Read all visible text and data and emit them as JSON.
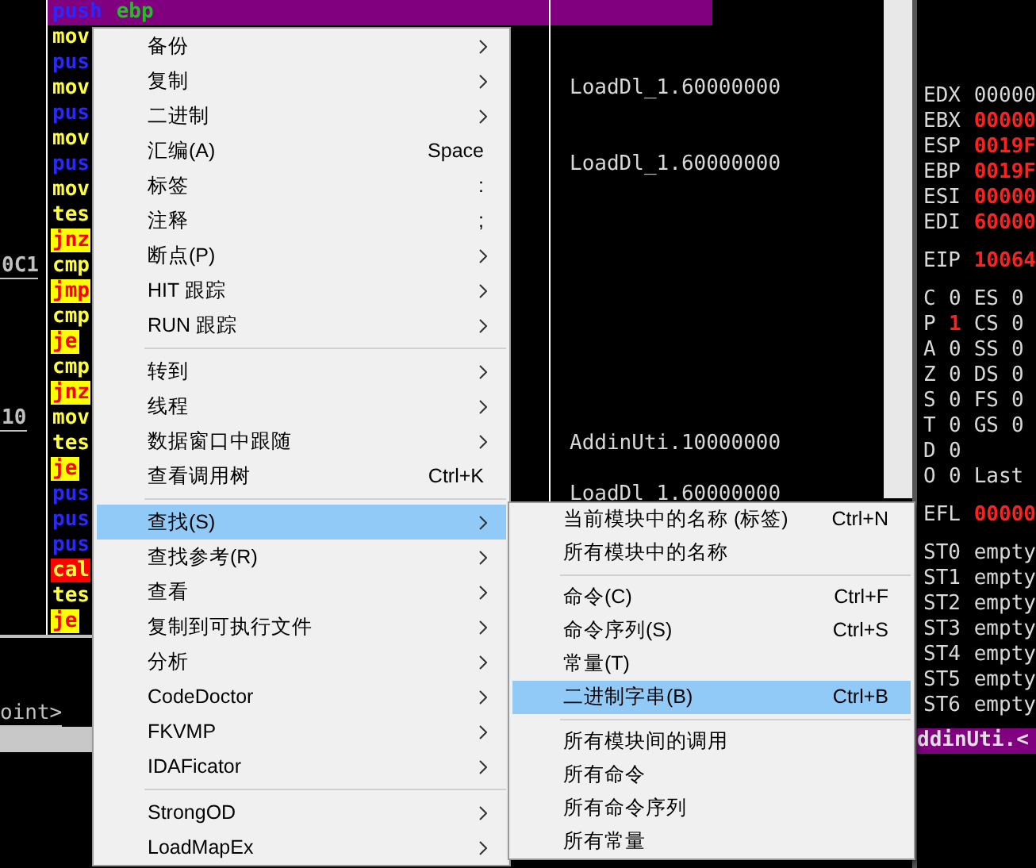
{
  "listing": [
    {
      "mnemonic": "push",
      "operand": "ebp",
      "kind": "push",
      "selected": true
    },
    {
      "mnemonic": "mov",
      "kind": "move",
      "selected": false
    },
    {
      "mnemonic": "pus",
      "kind": "push",
      "selected": false
    },
    {
      "mnemonic": "mov",
      "kind": "move",
      "comment": "LoadDl_1.60000000",
      "selected": false
    },
    {
      "mnemonic": "pus",
      "kind": "push",
      "selected": false
    },
    {
      "mnemonic": "mov",
      "kind": "move",
      "selected": false
    },
    {
      "mnemonic": "pus",
      "kind": "push",
      "comment": "LoadDl_1.60000000",
      "selected": false
    },
    {
      "mnemonic": "mov",
      "kind": "move",
      "selected": false
    },
    {
      "mnemonic": "tes",
      "kind": "test",
      "selected": false
    },
    {
      "mnemonic": "jnz",
      "kind": "jump",
      "selected": false
    },
    {
      "address": "0C1",
      "mnemonic": "cmp",
      "kind": "compare",
      "selected": false
    },
    {
      "mnemonic": "jmp",
      "kind": "jump",
      "selected": false
    },
    {
      "mnemonic": "cmp",
      "kind": "compare",
      "selected": false
    },
    {
      "mnemonic": "je",
      "kind": "jump",
      "selected": false
    },
    {
      "mnemonic": "cmp",
      "kind": "compare",
      "selected": false
    },
    {
      "mnemonic": "jnz",
      "kind": "jump",
      "selected": false
    },
    {
      "address": "10",
      "mnemonic": "mov",
      "kind": "move",
      "selected": false
    },
    {
      "mnemonic": "tes",
      "kind": "test",
      "comment": "AddinUti.10000000",
      "selected": false
    },
    {
      "mnemonic": "je",
      "kind": "jump",
      "selected": false
    },
    {
      "mnemonic": "pus",
      "kind": "push",
      "comment": "LoadDl_1.60000000",
      "selected": false
    },
    {
      "mnemonic": "pus",
      "kind": "push",
      "selected": false
    },
    {
      "mnemonic": "pus",
      "kind": "push",
      "selected": false
    },
    {
      "mnemonic": "cal",
      "kind": "call",
      "selected": false
    },
    {
      "mnemonic": "tes",
      "kind": "test",
      "selected": false
    },
    {
      "mnemonic": "je",
      "kind": "jump",
      "selected": false
    }
  ],
  "bottom_pane": {
    "text": "oint>"
  },
  "registers": [
    {
      "kind": "register",
      "name": "EDX",
      "value": "00000",
      "changed": false
    },
    {
      "kind": "register",
      "name": "EBX",
      "value": "00000",
      "changed": true
    },
    {
      "kind": "register",
      "name": "ESP",
      "value": "0019F",
      "changed": true
    },
    {
      "kind": "register",
      "name": "EBP",
      "value": "0019F",
      "changed": true
    },
    {
      "kind": "register",
      "name": "ESI",
      "value": "00000",
      "changed": true
    },
    {
      "kind": "register",
      "name": "EDI",
      "value": "60000",
      "changed": true
    },
    {
      "kind": "gap"
    },
    {
      "kind": "register",
      "name": "EIP",
      "value": "10064",
      "changed": true
    },
    {
      "kind": "gap"
    },
    {
      "kind": "flag",
      "name": "C",
      "value": "0",
      "changed": false,
      "segment": "ES",
      "segment_value": "0"
    },
    {
      "kind": "flag",
      "name": "P",
      "value": "1",
      "changed": true,
      "segment": "CS",
      "segment_value": "0"
    },
    {
      "kind": "flag",
      "name": "A",
      "value": "0",
      "changed": false,
      "segment": "SS",
      "segment_value": "0"
    },
    {
      "kind": "flag",
      "name": "Z",
      "value": "0",
      "changed": false,
      "segment": "DS",
      "segment_value": "0"
    },
    {
      "kind": "flag",
      "name": "S",
      "value": "0",
      "changed": false,
      "segment": "FS",
      "segment_value": "0"
    },
    {
      "kind": "flag",
      "name": "T",
      "value": "0",
      "changed": false,
      "segment": "GS",
      "segment_value": "0"
    },
    {
      "kind": "flag",
      "name": "D",
      "value": "0",
      "changed": false
    },
    {
      "kind": "flag",
      "name": "O",
      "value": "0",
      "changed": false,
      "segment": "Last"
    },
    {
      "kind": "gap"
    },
    {
      "kind": "register",
      "name": "EFL",
      "value": "00000",
      "changed": true
    },
    {
      "kind": "gap"
    },
    {
      "kind": "register",
      "name": "ST0",
      "value": "empty",
      "changed": false
    },
    {
      "kind": "register",
      "name": "ST1",
      "value": "empty",
      "changed": false
    },
    {
      "kind": "register",
      "name": "ST2",
      "value": "empty",
      "changed": false
    },
    {
      "kind": "register",
      "name": "ST3",
      "value": "empty",
      "changed": false
    },
    {
      "kind": "register",
      "name": "ST4",
      "value": "empty",
      "changed": false
    },
    {
      "kind": "register",
      "name": "ST5",
      "value": "empty",
      "changed": false
    },
    {
      "kind": "register",
      "name": "ST6",
      "value": "empty",
      "changed": false
    }
  ],
  "stack_pane": {
    "text": "ddinUti.<"
  },
  "context_menu": [
    {
      "kind": "item",
      "label": "备份",
      "submenu": true,
      "selected": false
    },
    {
      "kind": "item",
      "label": "复制",
      "submenu": true,
      "selected": false
    },
    {
      "kind": "item",
      "label": "二进制",
      "submenu": true,
      "selected": false
    },
    {
      "kind": "item",
      "label": "汇编(A)",
      "shortcut": "Space",
      "submenu": false,
      "selected": false
    },
    {
      "kind": "item",
      "label": "标签",
      "shortcut": ":",
      "submenu": false,
      "selected": false
    },
    {
      "kind": "item",
      "label": "注释",
      "shortcut": ";",
      "submenu": false,
      "selected": false
    },
    {
      "kind": "item",
      "label": "断点(P)",
      "submenu": true,
      "selected": false
    },
    {
      "kind": "item",
      "label": "HIT 跟踪",
      "submenu": true,
      "selected": false
    },
    {
      "kind": "item",
      "label": "RUN 跟踪",
      "submenu": true,
      "selected": false
    },
    {
      "kind": "separator"
    },
    {
      "kind": "item",
      "label": "转到",
      "submenu": true,
      "selected": false
    },
    {
      "kind": "item",
      "label": "线程",
      "submenu": true,
      "selected": false
    },
    {
      "kind": "item",
      "label": "数据窗口中跟随",
      "submenu": true,
      "selected": false
    },
    {
      "kind": "item",
      "label": "查看调用树",
      "shortcut": "Ctrl+K",
      "submenu": false,
      "selected": false
    },
    {
      "kind": "separator"
    },
    {
      "kind": "item",
      "label": "查找(S)",
      "submenu": true,
      "selected": true
    },
    {
      "kind": "item",
      "label": "查找参考(R)",
      "submenu": true,
      "selected": false
    },
    {
      "kind": "item",
      "label": "查看",
      "submenu": true,
      "selected": false
    },
    {
      "kind": "item",
      "label": "复制到可执行文件",
      "submenu": true,
      "selected": false
    },
    {
      "kind": "item",
      "label": "分析",
      "submenu": true,
      "selected": false
    },
    {
      "kind": "item",
      "label": "CodeDoctor",
      "submenu": true,
      "selected": false
    },
    {
      "kind": "item",
      "label": "FKVMP",
      "submenu": true,
      "selected": false
    },
    {
      "kind": "item",
      "label": "IDAFicator",
      "submenu": true,
      "selected": false
    },
    {
      "kind": "separator"
    },
    {
      "kind": "item",
      "label": "StrongOD",
      "submenu": true,
      "selected": false
    },
    {
      "kind": "item",
      "label": "LoadMapEx",
      "submenu": true,
      "selected": false
    }
  ],
  "search_submenu": [
    {
      "kind": "item",
      "label": "当前模块中的名称 (标签)",
      "shortcut": "Ctrl+N",
      "selected": false
    },
    {
      "kind": "item",
      "label": "所有模块中的名称",
      "selected": false
    },
    {
      "kind": "separator"
    },
    {
      "kind": "item",
      "label": "命令(C)",
      "shortcut": "Ctrl+F",
      "selected": false
    },
    {
      "kind": "item",
      "label": "命令序列(S)",
      "shortcut": "Ctrl+S",
      "selected": false
    },
    {
      "kind": "item",
      "label": "常量(T)",
      "selected": false
    },
    {
      "kind": "item",
      "label": "二进制字串(B)",
      "shortcut": "Ctrl+B",
      "selected": true
    },
    {
      "kind": "separator"
    },
    {
      "kind": "item",
      "label": "所有模块间的调用",
      "selected": false
    },
    {
      "kind": "item",
      "label": "所有命令",
      "selected": false
    },
    {
      "kind": "item",
      "label": "所有命令序列",
      "selected": false
    },
    {
      "kind": "item",
      "label": "所有常量",
      "selected": false
    }
  ]
}
